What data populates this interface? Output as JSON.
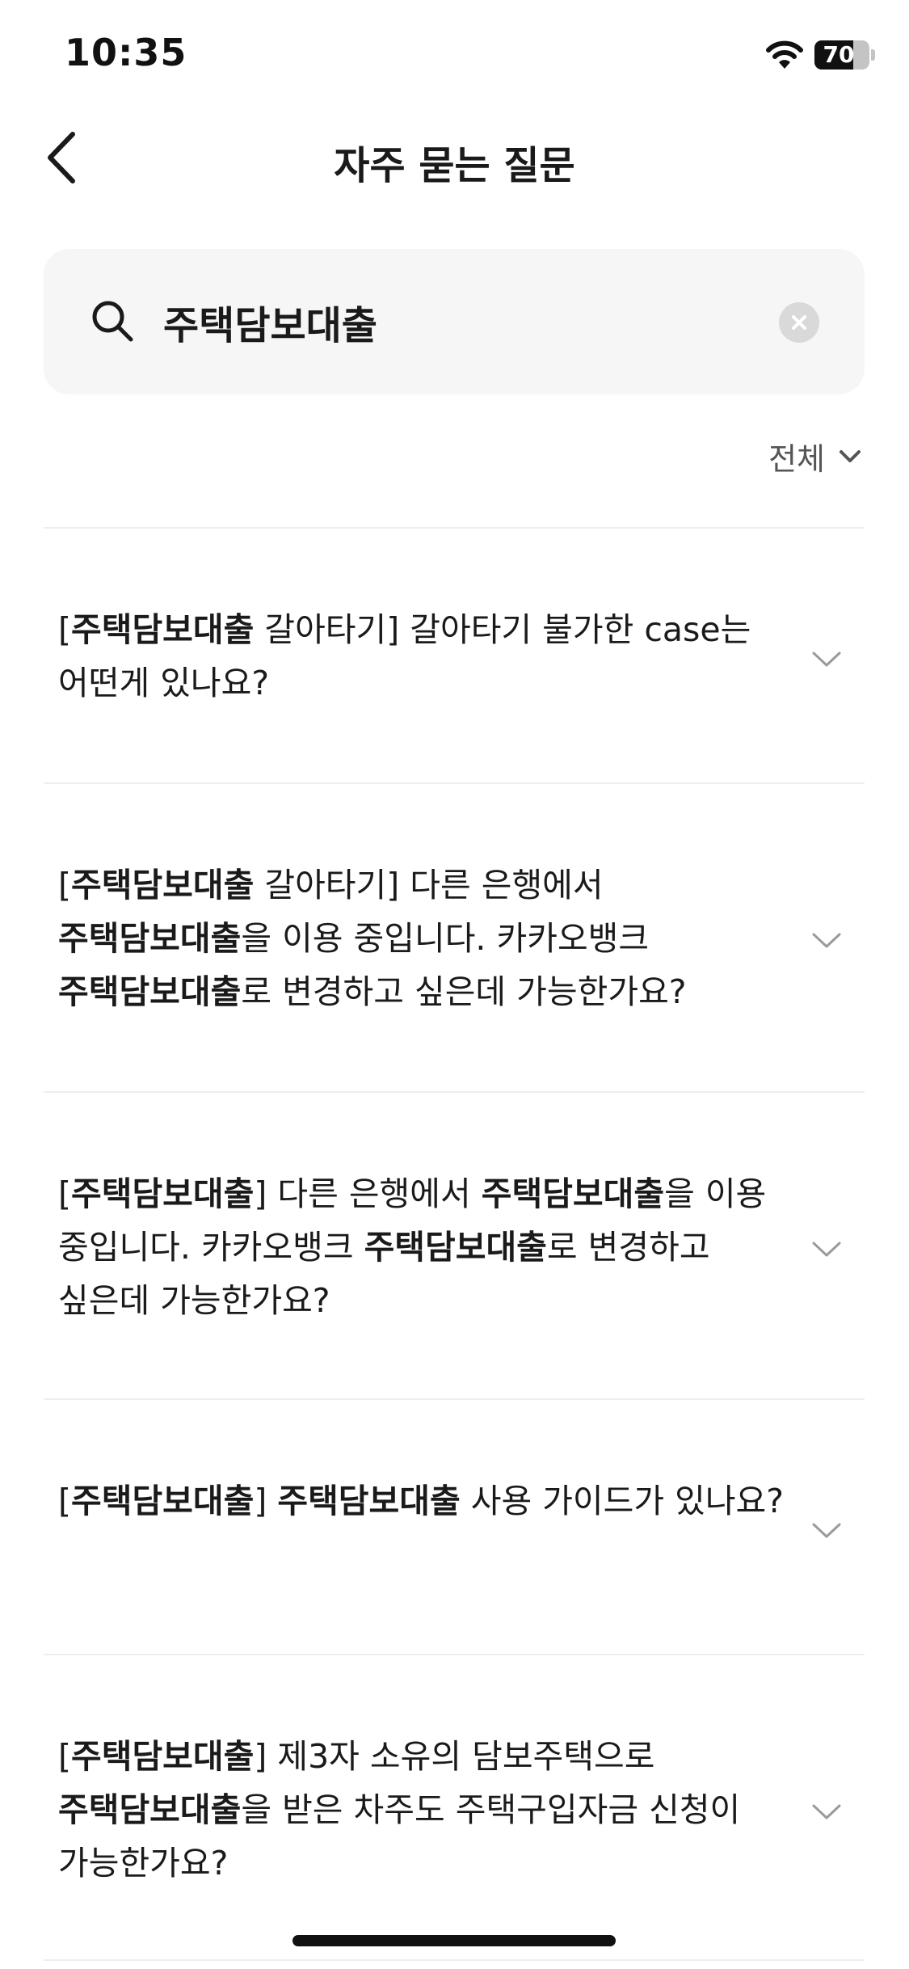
{
  "status_bar": {
    "time": "10:35",
    "battery_level": "70",
    "battery_fraction": 0.7
  },
  "header": {
    "title": "자주 묻는 질문",
    "back_icon": "chevron-left-icon"
  },
  "search": {
    "value": "주택담보대출",
    "search_icon": "search-icon",
    "clear_icon": "clear-icon"
  },
  "filter": {
    "label": "전체",
    "icon": "chevron-down-icon"
  },
  "faq_items": [
    {
      "segments": [
        {
          "text": "[",
          "bold": false
        },
        {
          "text": "주택담보대출",
          "bold": true
        },
        {
          "text": " 갈아타기] 갈아타기 불가한 case는 어떤게 있나요?",
          "bold": false
        }
      ]
    },
    {
      "segments": [
        {
          "text": "[",
          "bold": false
        },
        {
          "text": "주택담보대출",
          "bold": true
        },
        {
          "text": " 갈아타기] 다른 은행에서 ",
          "bold": false
        },
        {
          "text": "주택담보대출",
          "bold": true
        },
        {
          "text": "을 이용 중입니다. 카카오뱅크 ",
          "bold": false
        },
        {
          "text": "주택담보대출",
          "bold": true
        },
        {
          "text": "로 변경하고 싶은데 가능한가요?",
          "bold": false
        }
      ]
    },
    {
      "segments": [
        {
          "text": "[",
          "bold": false
        },
        {
          "text": "주택담보대출",
          "bold": true
        },
        {
          "text": "] 다른 은행에서 ",
          "bold": false
        },
        {
          "text": "주택담보대출",
          "bold": true
        },
        {
          "text": "을 이용 중입니다. 카카오뱅크 ",
          "bold": false
        },
        {
          "text": "주택담보대출",
          "bold": true
        },
        {
          "text": "로 변경하고 싶은데 가능한가요?",
          "bold": false
        }
      ]
    },
    {
      "segments": [
        {
          "text": "[",
          "bold": false
        },
        {
          "text": "주택담보대출",
          "bold": true
        },
        {
          "text": "] ",
          "bold": false
        },
        {
          "text": "주택담보대출",
          "bold": true
        },
        {
          "text": " 사용 가이드가 있나요?",
          "bold": false
        }
      ]
    },
    {
      "segments": [
        {
          "text": "[",
          "bold": false
        },
        {
          "text": "주택담보대출",
          "bold": true
        },
        {
          "text": "] 제3자 소유의 담보주택으로 ",
          "bold": false
        },
        {
          "text": "주택담보대출",
          "bold": true
        },
        {
          "text": "을 받은 차주도 주택구입자금 신청이 가능한가요?",
          "bold": false
        }
      ]
    }
  ]
}
